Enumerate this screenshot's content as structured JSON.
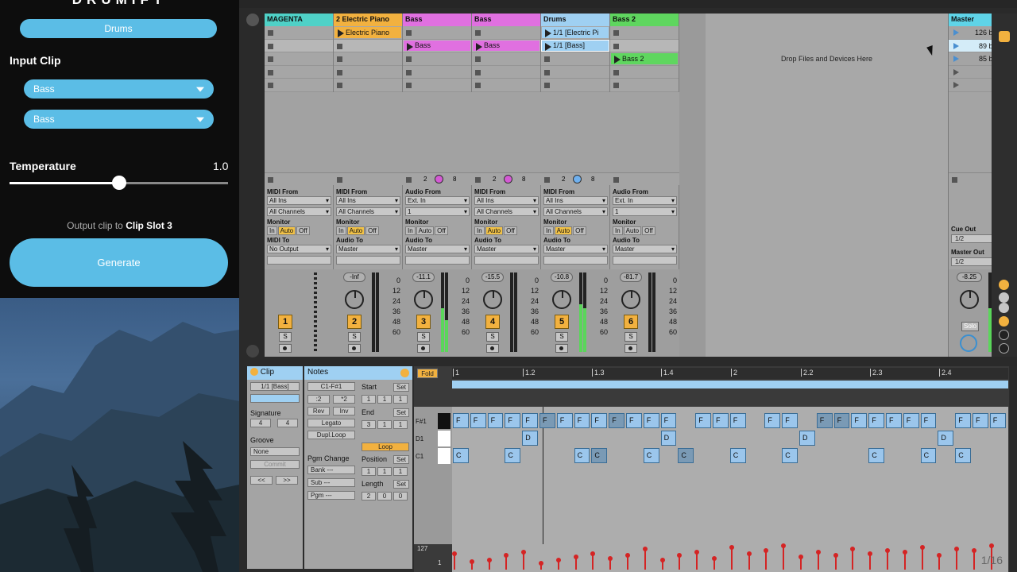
{
  "left_panel": {
    "app_title": "DRUMIFY",
    "mode_button": "Drums",
    "input_clip_label": "Input Clip",
    "input_dropdown_1": "Bass",
    "input_dropdown_2": "Bass",
    "temperature_label": "Temperature",
    "temperature_value": "1.0",
    "temperature_fraction": 0.5,
    "output_prefix": "Output clip to",
    "output_target": "Clip Slot 3",
    "generate_label": "Generate"
  },
  "session": {
    "tracks": [
      {
        "name": "MAGENTA",
        "color": "#4fd1c7",
        "io_from_label": "MIDI From",
        "from1": "All Ins",
        "from2": "All Channels",
        "to_label": "MIDI To",
        "to1": "No Output",
        "vol": "",
        "num": "1"
      },
      {
        "name": "2 Electric Piano",
        "color": "#f2b13f",
        "io_from_label": "MIDI From",
        "from1": "All Ins",
        "from2": "All Channels",
        "to_label": "Audio To",
        "to1": "Master",
        "vol": "-Inf",
        "num": "2"
      },
      {
        "name": "Bass",
        "color": "#e070e0",
        "io_from_label": "Audio From",
        "from1": "Ext. In",
        "from2": "1",
        "to_label": "Audio To",
        "to1": "Master",
        "vol": "-11.1",
        "num": "3"
      },
      {
        "name": "Bass",
        "color": "#e070e0",
        "io_from_label": "MIDI From",
        "from1": "All Ins",
        "from2": "All Channels",
        "to_label": "Audio To",
        "to1": "Master",
        "vol": "-15.5",
        "num": "4"
      },
      {
        "name": "Drums",
        "color": "#9fd0f2",
        "io_from_label": "MIDI From",
        "from1": "All Ins",
        "from2": "All Channels",
        "to_label": "Audio To",
        "to1": "Master",
        "vol": "-10.8",
        "num": "5"
      },
      {
        "name": "Bass 2",
        "color": "#5fd65f",
        "io_from_label": "Audio From",
        "from1": "Ext. In",
        "from2": "1",
        "to_label": "Audio To",
        "to1": "Master",
        "vol": "-81.7",
        "num": "6"
      }
    ],
    "clips": {
      "electric_piano": "Electric Piano",
      "bass_a": "Bass",
      "bass_b": "Bass",
      "drums_1": "1/1 [Electric Pi",
      "drums_2": "1/1 [Bass]",
      "bass2": "Bass 2"
    },
    "drop_text": "Drop Files and Devices Here",
    "monitor_label": "Monitor",
    "monitor_in": "In",
    "monitor_auto": "Auto",
    "monitor_off": "Off",
    "solo_label": "S",
    "scale": [
      "0",
      "12",
      "24",
      "36",
      "48",
      "60"
    ],
    "send_values": [
      "2",
      "8"
    ],
    "master": {
      "name": "Master",
      "scenes": [
        "126 bpm",
        "89 bpm",
        "85 bpm",
        "4",
        "5"
      ],
      "cue_out_label": "Cue Out",
      "cue_out": "1/2",
      "master_out_label": "Master Out",
      "master_out": "1/2",
      "vol": "-8.25",
      "solo": "Solo"
    }
  },
  "detail": {
    "clip_tab": "Clip",
    "notes_tab": "Notes",
    "fold": "Fold",
    "clip_name": "1/1 [Bass]",
    "signature_label": "Signature",
    "sig_num": "4",
    "sig_den": "4",
    "groove_label": "Groove",
    "groove_value": "None",
    "commit": "Commit",
    "range": "C1-F#1",
    "div2": ":2",
    "mul2": "*2",
    "rev": "Rev",
    "inv": "Inv",
    "legato": "Legato",
    "dupl": "Dupl.Loop",
    "pgm_change": "Pgm Change",
    "bank": "Bank ---",
    "sub": "Sub ---",
    "pgm": "Pgm ---",
    "start_label": "Start",
    "end_label": "End",
    "loop": "Loop",
    "position_label": "Position",
    "length_label": "Length",
    "set": "Set",
    "start_vals": [
      "1",
      "1",
      "1"
    ],
    "end_vals": [
      "3",
      "1",
      "1"
    ],
    "pos_vals": [
      "1",
      "1",
      "1"
    ],
    "len_vals": [
      "2",
      "0",
      "0"
    ],
    "ruler": [
      "1",
      "1.2",
      "1.3",
      "1.4",
      "2",
      "2.2",
      "2.3",
      "2.4"
    ],
    "keys": [
      "F#1",
      "D1",
      "C1"
    ],
    "velo_max": "127",
    "velo_min": "1",
    "grid_label": "1/16"
  }
}
